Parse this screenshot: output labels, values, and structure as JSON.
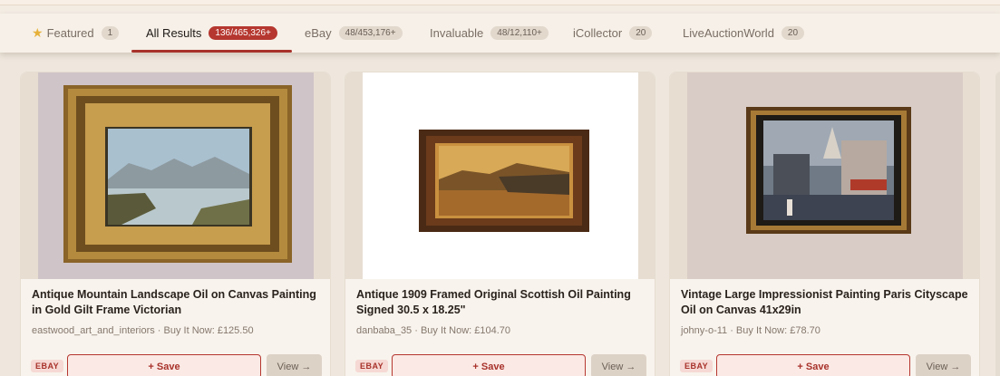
{
  "tabs": [
    {
      "label": "Featured",
      "count": "1",
      "active": false
    },
    {
      "label": "All Results",
      "count": "136/465,326+",
      "active": true
    },
    {
      "label": "eBay",
      "count": "48/453,176+",
      "active": false
    },
    {
      "label": "Invaluable",
      "count": "48/12,110+",
      "active": false
    },
    {
      "label": "iCollector",
      "count": "20",
      "active": false
    },
    {
      "label": "LiveAuctionWorld",
      "count": "20",
      "active": false
    }
  ],
  "cards": [
    {
      "title": "Antique Mountain Landscape Oil on Canvas Painting in Gold Gilt Frame Victorian",
      "seller": "eastwood_art_and_interiors · Buy It Now: £125.50",
      "source": "EBAY",
      "save_label": "+ Save",
      "view_label": "View →",
      "image": "gilt-framed-mountain-lake-painting"
    },
    {
      "title": "Antique 1909 Framed Original Scottish Oil Painting Signed 30.5 x 18.25\"",
      "seller": "danbaba_35 · Buy It Now: £104.70",
      "source": "EBAY",
      "save_label": "+ Save",
      "view_label": "View →",
      "image": "framed-scottish-landscape-painting"
    },
    {
      "title": "Vintage Large Impressionist Painting Paris Cityscape Oil on Canvas 41x29in",
      "seller": "johny-o-11 · Buy It Now: £78.70",
      "source": "EBAY",
      "save_label": "+ Save",
      "view_label": "View →",
      "image": "framed-paris-street-painting"
    }
  ],
  "colors": {
    "accent": "#b5372f",
    "background": "#efe7dd",
    "card": "#f8f3ed"
  }
}
